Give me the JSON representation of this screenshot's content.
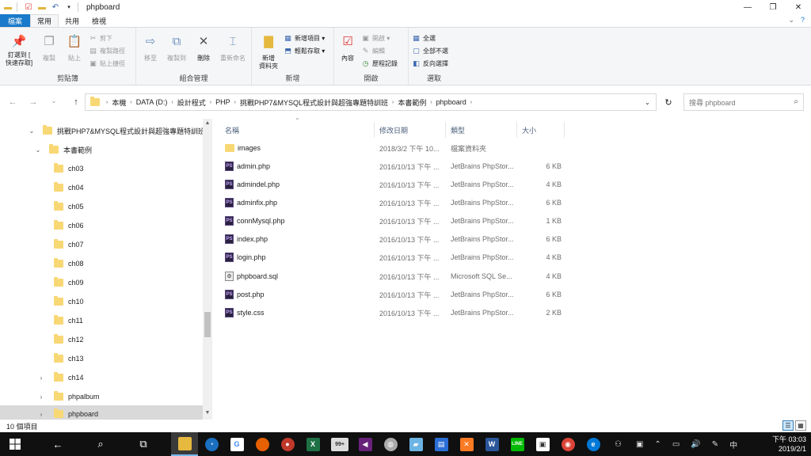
{
  "window": {
    "title": "phpboard",
    "controls": {
      "minimize": "—",
      "maximize": "❐",
      "close": "✕"
    }
  },
  "tabs": [
    {
      "label": "檔案"
    },
    {
      "label": "常用"
    },
    {
      "label": "共用"
    },
    {
      "label": "檢視"
    }
  ],
  "ribbon": {
    "clipboard": {
      "group_label": "剪貼簿",
      "pin_line1": "釘選到 [",
      "pin_line2": "快速存取]",
      "copy": "複製",
      "paste": "貼上",
      "cut": "剪下",
      "copy_path": "複製路徑",
      "paste_shortcut": "貼上捷徑"
    },
    "organize": {
      "group_label": "組合管理",
      "move_to": "移至",
      "copy_to": "複製到",
      "delete": "刪除",
      "rename": "重新命名"
    },
    "new": {
      "group_label": "新增",
      "new_folder_line1": "新增",
      "new_folder_line2": "資料夾",
      "new_item": "新增項目 ▾",
      "easy_access": "輕鬆存取 ▾"
    },
    "open": {
      "group_label": "開啟",
      "properties": "內容",
      "open": "開啟 ▾",
      "edit": "編輯",
      "history": "歷程記錄"
    },
    "select": {
      "group_label": "選取",
      "select_all": "全選",
      "select_none": "全部不選",
      "invert": "反向選擇"
    }
  },
  "address": {
    "crumbs": [
      "本機",
      "DATA (D:)",
      "設計程式",
      "PHP",
      "挑戰PHP7&MYSQL程式設計與超強專題特訓班",
      "本書範例",
      "phpboard"
    ],
    "search_placeholder": "搜尋 phpboard"
  },
  "tree": [
    {
      "label": "挑戰PHP7&MYSQL程式設計與超強專題特訓班",
      "caret": "⌄",
      "indent": 0
    },
    {
      "label": "本書範例",
      "caret": "⌄",
      "indent": 1
    },
    {
      "label": "ch03",
      "caret": "",
      "indent": 2
    },
    {
      "label": "ch04",
      "caret": "",
      "indent": 2
    },
    {
      "label": "ch05",
      "caret": "",
      "indent": 2
    },
    {
      "label": "ch06",
      "caret": "",
      "indent": 2
    },
    {
      "label": "ch07",
      "caret": "",
      "indent": 2
    },
    {
      "label": "ch08",
      "caret": "",
      "indent": 2
    },
    {
      "label": "ch09",
      "caret": "",
      "indent": 2
    },
    {
      "label": "ch10",
      "caret": "",
      "indent": 2
    },
    {
      "label": "ch11",
      "caret": "",
      "indent": 2
    },
    {
      "label": "ch12",
      "caret": "",
      "indent": 2
    },
    {
      "label": "ch13",
      "caret": "",
      "indent": 2
    },
    {
      "label": "ch14",
      "caret": "›",
      "indent": 2
    },
    {
      "label": "phpalbum",
      "caret": "›",
      "indent": 2
    },
    {
      "label": "phpboard",
      "caret": "›",
      "indent": 2,
      "selected": true
    }
  ],
  "columns": {
    "name": "名稱",
    "modified": "修改日期",
    "type": "類型",
    "size": "大小"
  },
  "files": [
    {
      "name": "images",
      "modified": "2018/3/2 下午 10...",
      "type": "檔案資料夾",
      "size": "",
      "icon": "folder"
    },
    {
      "name": "admin.php",
      "modified": "2016/10/13 下午 ...",
      "type": "JetBrains PhpStor...",
      "size": "6 KB",
      "icon": "php"
    },
    {
      "name": "admindel.php",
      "modified": "2016/10/13 下午 ...",
      "type": "JetBrains PhpStor...",
      "size": "4 KB",
      "icon": "php"
    },
    {
      "name": "adminfix.php",
      "modified": "2016/10/13 下午 ...",
      "type": "JetBrains PhpStor...",
      "size": "6 KB",
      "icon": "php"
    },
    {
      "name": "connMysql.php",
      "modified": "2016/10/13 下午 ...",
      "type": "JetBrains PhpStor...",
      "size": "1 KB",
      "icon": "php"
    },
    {
      "name": "index.php",
      "modified": "2016/10/13 下午 ...",
      "type": "JetBrains PhpStor...",
      "size": "6 KB",
      "icon": "php"
    },
    {
      "name": "login.php",
      "modified": "2016/10/13 下午 ...",
      "type": "JetBrains PhpStor...",
      "size": "4 KB",
      "icon": "php"
    },
    {
      "name": "phpboard.sql",
      "modified": "2016/10/13 下午 ...",
      "type": "Microsoft SQL Se...",
      "size": "4 KB",
      "icon": "sql"
    },
    {
      "name": "post.php",
      "modified": "2016/10/13 下午 ...",
      "type": "JetBrains PhpStor...",
      "size": "6 KB",
      "icon": "php"
    },
    {
      "name": "style.css",
      "modified": "2016/10/13 下午 ...",
      "type": "JetBrains PhpStor...",
      "size": "2 KB",
      "icon": "css"
    }
  ],
  "status": {
    "item_count": "10 個項目"
  },
  "taskbar": {
    "ime": "中",
    "time": "下午 03:03",
    "date": "2019/2/1",
    "badge": "99+"
  },
  "colors": {
    "accent": "#1979ca",
    "folder": "#f8d775",
    "selection": "#d9d9d9"
  }
}
